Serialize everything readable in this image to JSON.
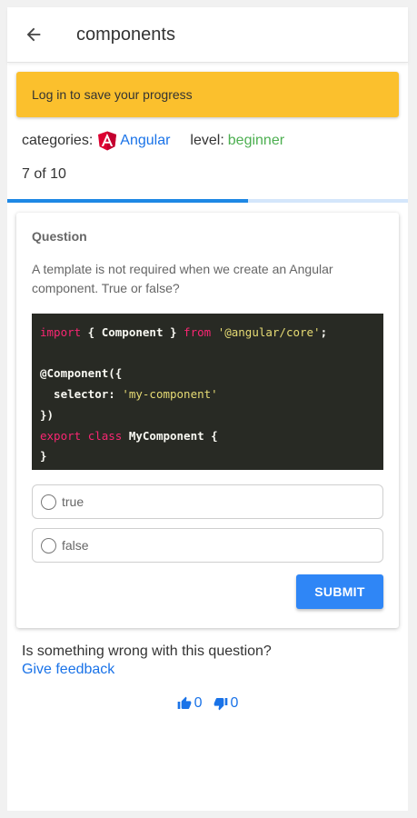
{
  "appbar": {
    "title": "components"
  },
  "banner": {
    "text": "Log in to save your progress"
  },
  "meta": {
    "categories_label": "categories:",
    "category": "Angular",
    "level_label": "level:",
    "level": "beginner"
  },
  "progress": {
    "text": "7 of 10",
    "fraction": 0.6
  },
  "question": {
    "label": "Question",
    "text": "A template is not required when we create an Angular component. True or false?",
    "code_lines": [
      [
        {
          "t": "import",
          "c": "kw"
        },
        {
          "t": " { Component } "
        },
        {
          "t": "from",
          "c": "kw"
        },
        {
          "t": " "
        },
        {
          "t": "'@angular/core'",
          "c": "str"
        },
        {
          "t": ";"
        }
      ],
      [],
      [
        {
          "t": "@Component({"
        }
      ],
      [
        {
          "t": "  selector: "
        },
        {
          "t": "'my-component'",
          "c": "str"
        }
      ],
      [
        {
          "t": "})"
        }
      ],
      [
        {
          "t": "export",
          "c": "kw"
        },
        {
          "t": " "
        },
        {
          "t": "class",
          "c": "kw"
        },
        {
          "t": " MyComponent {"
        }
      ],
      [
        {
          "t": "}"
        }
      ]
    ],
    "options": [
      "true",
      "false"
    ],
    "submit_label": "SUBMIT"
  },
  "feedback": {
    "prompt": "Is something wrong with this question?",
    "link": "Give feedback"
  },
  "votes": {
    "up": "0",
    "down": "0"
  },
  "colors": {
    "banner": "#fbc02d",
    "accent": "#2f86f6",
    "link": "#1a73e8",
    "level": "#4caf50",
    "angular": "#dd0031"
  }
}
